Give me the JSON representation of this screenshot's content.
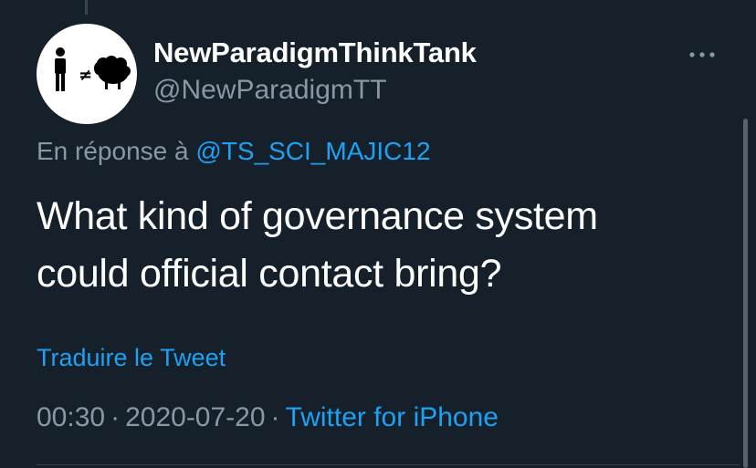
{
  "tweet": {
    "author": {
      "display_name": "NewParadigmThinkTank",
      "handle": "@NewParadigmTT",
      "avatar_icon": "person-not-equal-sheep-logo"
    },
    "reply_prefix": "En réponse à",
    "reply_to": "@TS_SCI_MAJIC12",
    "text_line1": "What kind of governance system",
    "text_line2": "could official contact bring?",
    "translate_label": "Traduire le Tweet",
    "time": "00:30",
    "separator": "·",
    "date": "2020-07-20",
    "source": "Twitter for iPhone"
  },
  "menu": {
    "more_icon": "more-options-icon"
  },
  "colors": {
    "background": "#15202b",
    "primary_text": "#ffffff",
    "secondary_text": "#8899a6",
    "accent": "#1da1f2",
    "divider": "#38444d"
  }
}
